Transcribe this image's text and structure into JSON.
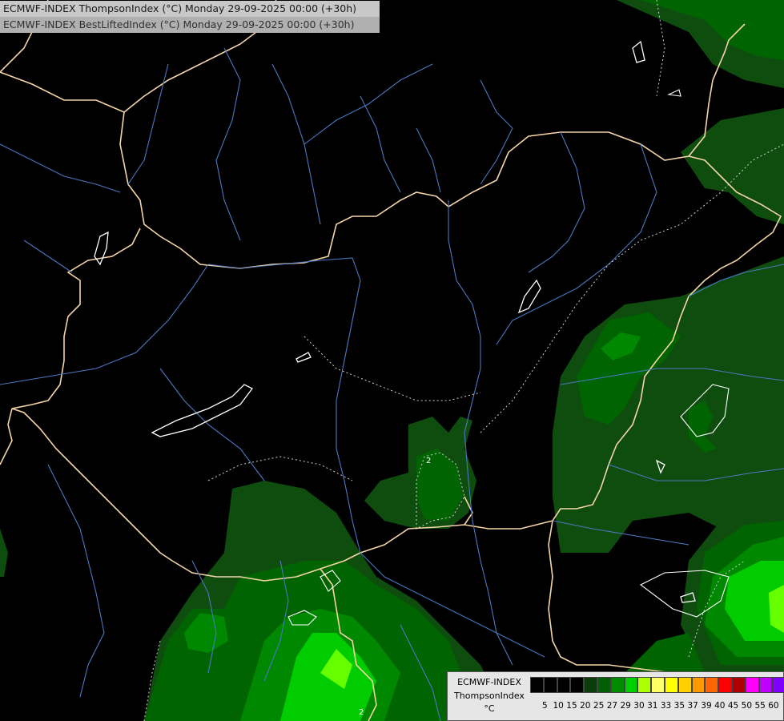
{
  "header": {
    "line1": "ECMWF-INDEX ThompsonIndex (°C) Monday 29-09-2025 00:00 (+30h)",
    "line2": "ECMWF-INDEX BestLiftedIndex (°C) Monday 29-09-2025 00:00 (+30h)"
  },
  "legend": {
    "model": "ECMWF-INDEX",
    "parameter": "ThompsonIndex",
    "unit": "°C",
    "ticks": [
      "5",
      "10",
      "15",
      "20",
      "25",
      "27",
      "29",
      "30",
      "31",
      "33",
      "35",
      "37",
      "39",
      "40",
      "45",
      "50",
      "55",
      "60"
    ],
    "colors": [
      "#000000",
      "#000000",
      "#000000",
      "#000000",
      "#0a3d0a",
      "#005f00",
      "#008c00",
      "#00d000",
      "#aaff00",
      "#ffff66",
      "#ffff00",
      "#ffd000",
      "#ff9900",
      "#ff6600",
      "#ff0000",
      "#b00000",
      "#ff00ff",
      "#c000ff",
      "#8000ff",
      "#4000ff",
      "#0000ff"
    ]
  },
  "map_colors": {
    "background": "#000000",
    "level_25": "#0f4d0f",
    "level_27": "#006400",
    "level_29": "#008800",
    "level_30": "#00cc00",
    "level_31": "#66ff00",
    "border": "#f5d5a8",
    "river": "#4a78c0",
    "lifted_contour": "#ffffff",
    "lifted_zero": "#d0d0d0"
  },
  "contour_labels": [
    "2",
    "2"
  ]
}
